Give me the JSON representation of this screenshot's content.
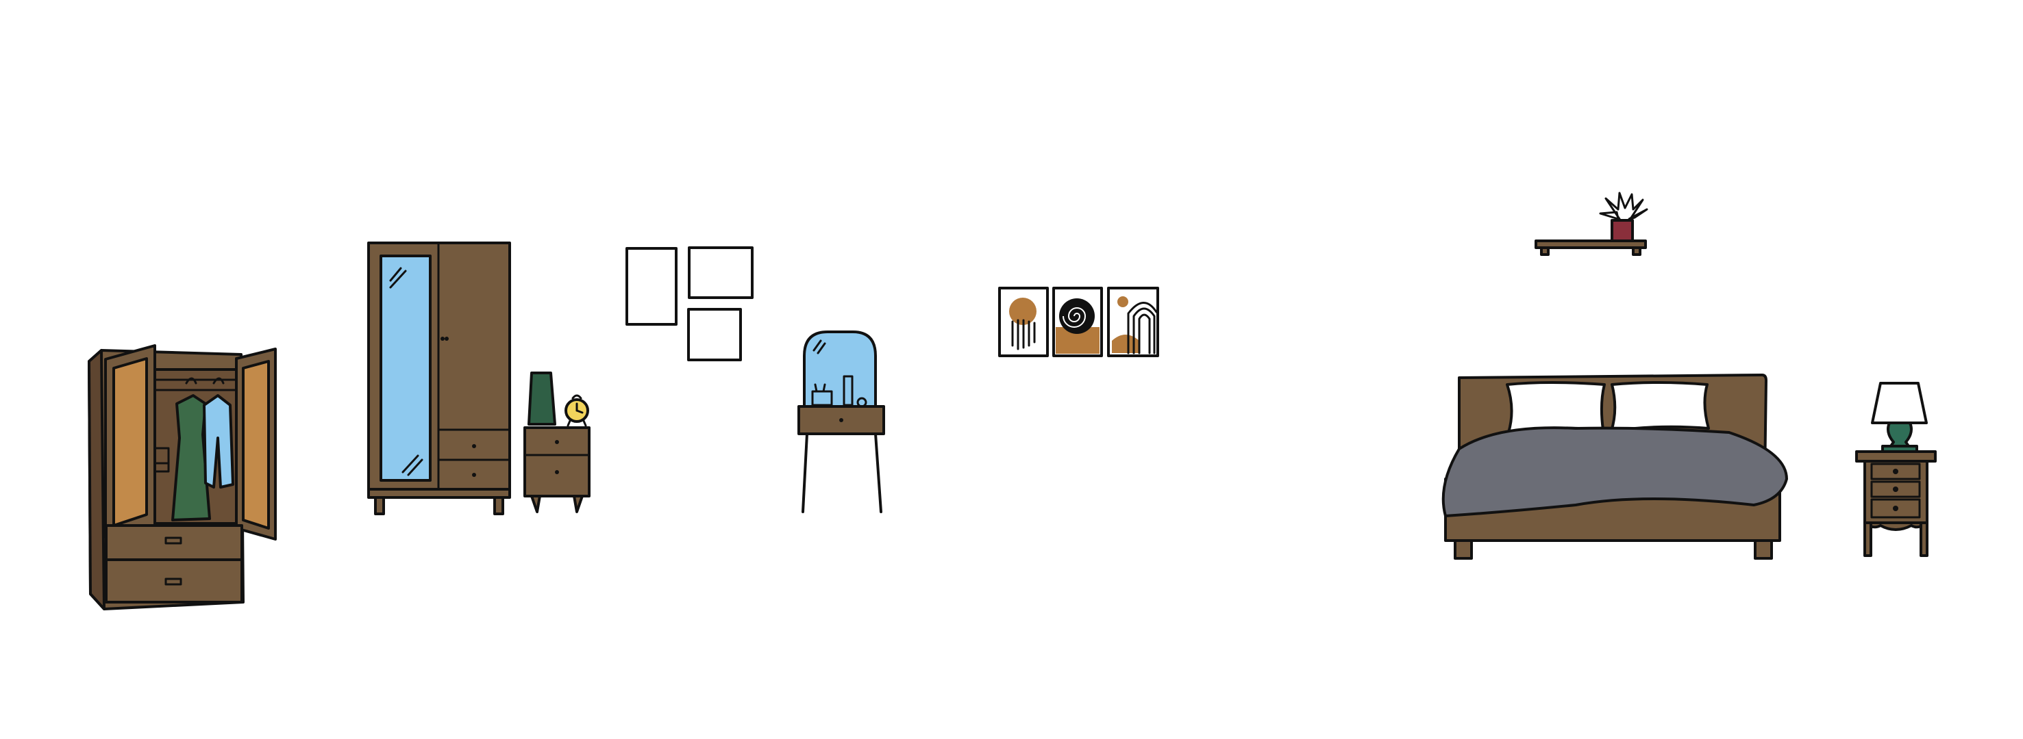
{
  "scene": {
    "background": "#ffffff",
    "items": [
      "open-wardrobe",
      "mirror-wardrobe",
      "nightstand-with-clock",
      "empty-frames",
      "vanity-table",
      "abstract-art-triptych",
      "wall-shelf-with-plant",
      "double-bed",
      "bedside-table-with-lamp"
    ]
  },
  "colors": {
    "wood": "#745a3e",
    "wood_dark": "#5e4530",
    "door_inner": "#c28a4a",
    "mirror": "#8ec9ee",
    "blanket": "#6b6d76",
    "pillow": "#ffffff",
    "dress_green": "#3c6b48",
    "shirt_blue": "#8ec9ee",
    "clock_yellow": "#f2d45c",
    "vase_green": "#2f5f45",
    "plant_pot": "#8a2f3b",
    "plant_leaf": "#3f7a52",
    "art_ochre": "#b47a3c",
    "drawer_tan": "#c9955a"
  }
}
